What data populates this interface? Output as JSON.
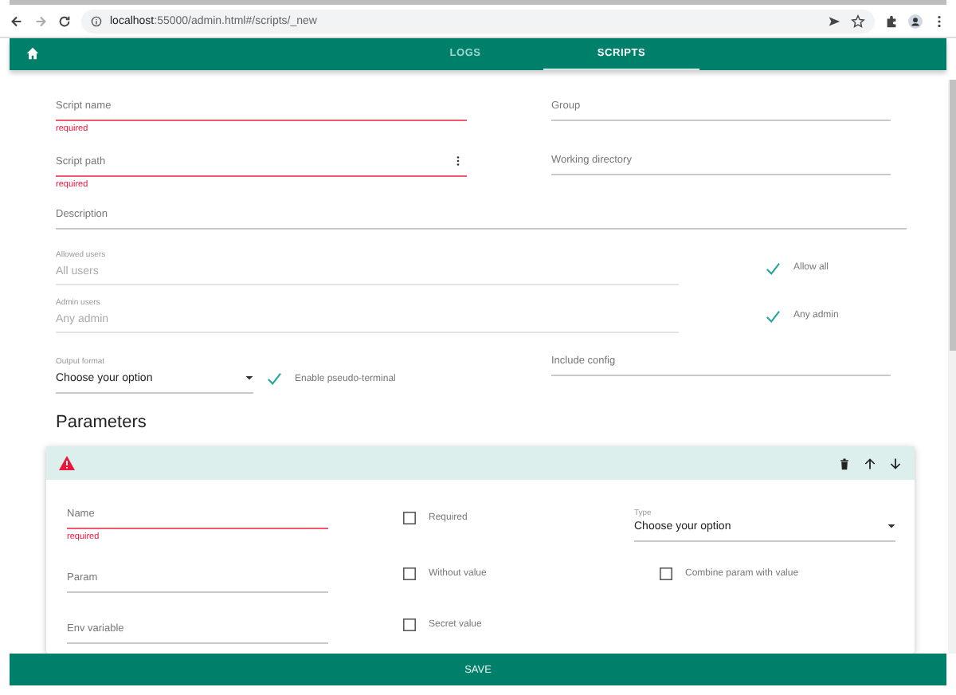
{
  "browser": {
    "url_host": "localhost",
    "url_path": ":55000/admin.html#/scripts/_new"
  },
  "nav": {
    "tabs": [
      {
        "label": "LOGS",
        "selected": false
      },
      {
        "label": "SCRIPTS",
        "selected": true
      }
    ]
  },
  "form": {
    "script_name": {
      "label": "Script name",
      "error": "required"
    },
    "group": {
      "label": "Group"
    },
    "script_path": {
      "label": "Script path",
      "error": "required"
    },
    "working_directory": {
      "label": "Working directory"
    },
    "description": {
      "label": "Description"
    },
    "allowed_users": {
      "label": "Allowed users",
      "placeholder": "All users"
    },
    "allow_all": {
      "label": "Allow all",
      "checked": true
    },
    "admin_users": {
      "label": "Admin users",
      "placeholder": "Any admin"
    },
    "any_admin": {
      "label": "Any admin",
      "checked": true
    },
    "output_format": {
      "label": "Output format",
      "value": "Choose your option"
    },
    "pseudo_terminal": {
      "label": "Enable pseudo-terminal",
      "checked": true
    },
    "include_config": {
      "label": "Include config"
    }
  },
  "parameters": {
    "title": "Parameters",
    "items": [
      {
        "has_error": true,
        "name": {
          "label": "Name",
          "error": "required"
        },
        "required": {
          "label": "Required",
          "checked": false
        },
        "type": {
          "label": "Type",
          "value": "Choose your option"
        },
        "param": {
          "label": "Param"
        },
        "without_value": {
          "label": "Without value",
          "checked": false
        },
        "combine": {
          "label": "Combine param with value",
          "checked": false
        },
        "env": {
          "label": "Env variable"
        },
        "secret": {
          "label": "Secret value",
          "checked": false
        }
      }
    ]
  },
  "save_button": "SAVE"
}
